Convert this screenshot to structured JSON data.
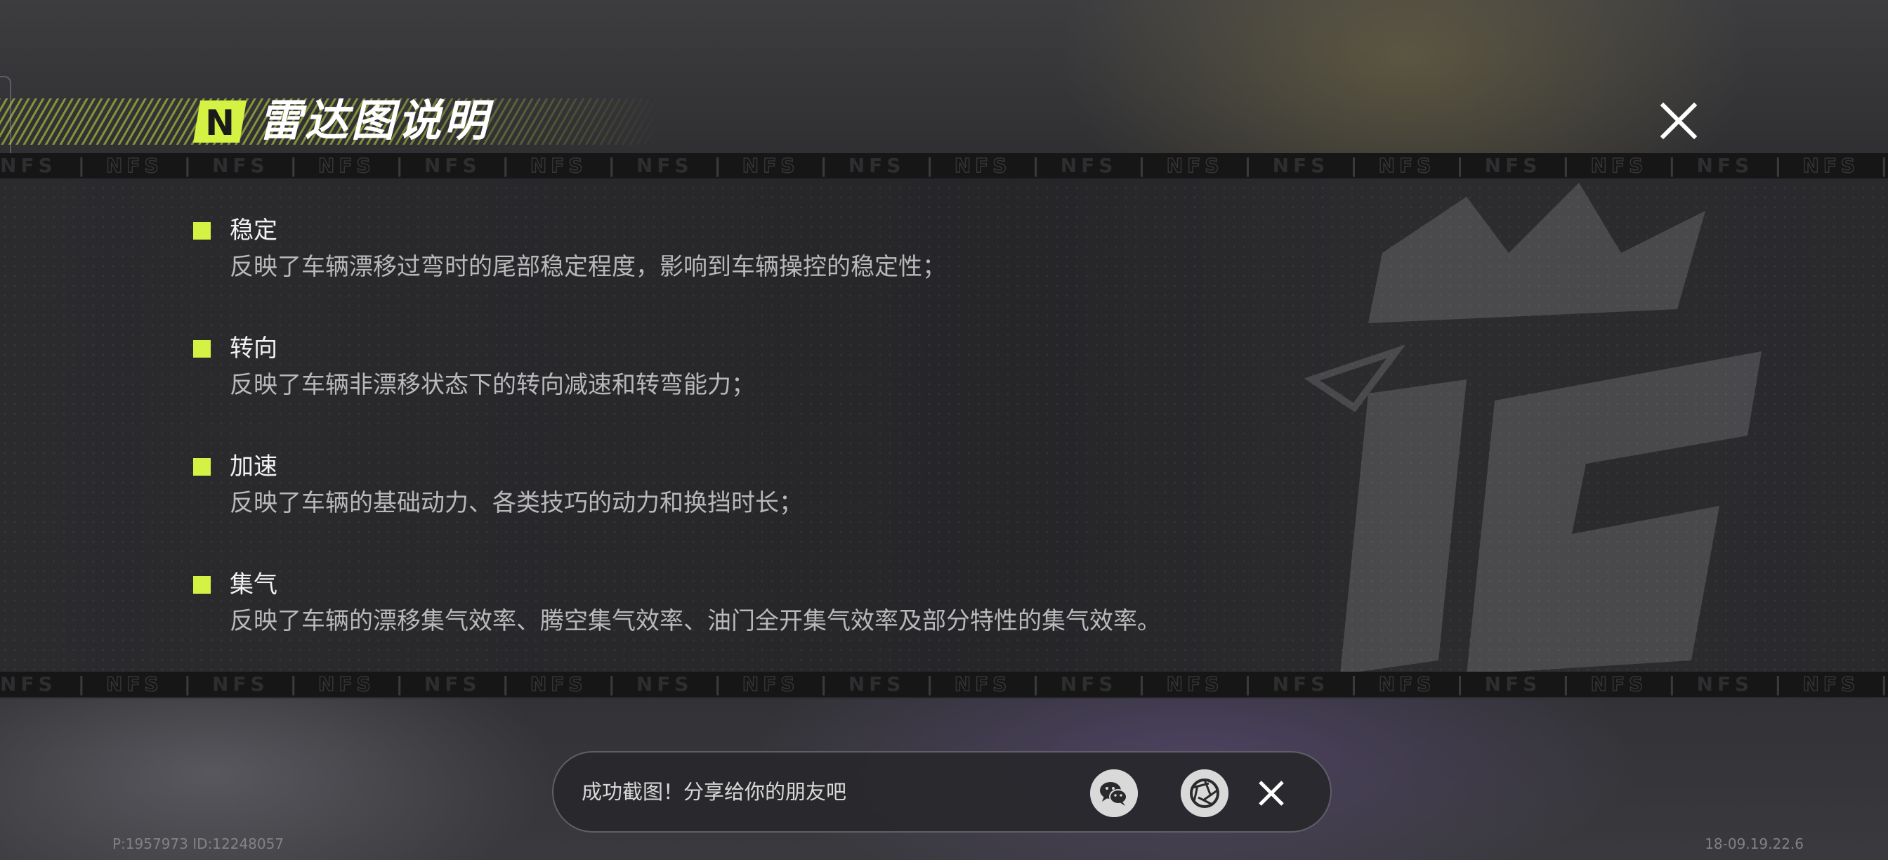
{
  "dialog": {
    "title": "雷达图说明",
    "logo_letter": "N",
    "close_label": "close",
    "strip_text": "NFS",
    "items": [
      {
        "heading": "稳定",
        "desc": "反映了车辆漂移过弯时的尾部稳定程度，影响到车辆操控的稳定性；"
      },
      {
        "heading": "转向",
        "desc": "反映了车辆非漂移状态下的转向减速和转弯能力；"
      },
      {
        "heading": "加速",
        "desc": "反映了车辆的基础动力、各类技巧的动力和换挡时长；"
      },
      {
        "heading": "集气",
        "desc": "反映了车辆的漂移集气效率、腾空集气效率、油门全开集气效率及部分特性的集气效率。"
      }
    ]
  },
  "toast": {
    "message": "成功截图！分享给你的朋友吧",
    "wechat_icon": "wechat-icon",
    "shutter_icon": "camera-shutter-icon",
    "close_icon": "close-icon"
  },
  "footer": {
    "left": "P:1957973 ID:12248057",
    "right": "18-09.19.22.6"
  },
  "colors": {
    "accent": "#d4f244",
    "panel": "#2a2a2d",
    "strip": "#161617"
  }
}
